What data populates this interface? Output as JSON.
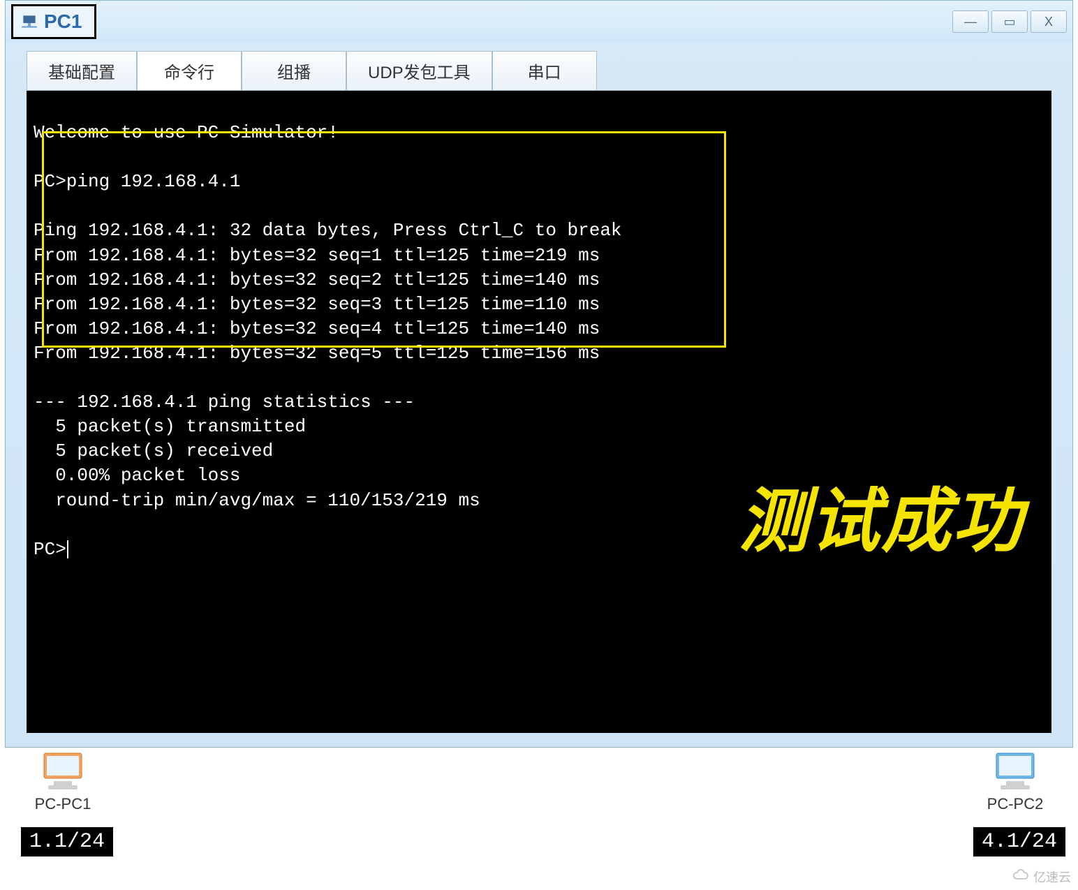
{
  "window": {
    "title": "PC1",
    "controls": {
      "min": "—",
      "max": "▭",
      "close": "X"
    }
  },
  "tabs": {
    "items": [
      {
        "label": "基础配置"
      },
      {
        "label": "命令行"
      },
      {
        "label": "组播"
      },
      {
        "label": "UDP发包工具"
      },
      {
        "label": "串口"
      }
    ],
    "active_index": 1
  },
  "terminal": {
    "lines": [
      "Welcome to use PC Simulator!",
      "",
      "PC>ping 192.168.4.1",
      "",
      "Ping 192.168.4.1: 32 data bytes, Press Ctrl_C to break",
      "From 192.168.4.1: bytes=32 seq=1 ttl=125 time=219 ms",
      "From 192.168.4.1: bytes=32 seq=2 ttl=125 time=140 ms",
      "From 192.168.4.1: bytes=32 seq=3 ttl=125 time=110 ms",
      "From 192.168.4.1: bytes=32 seq=4 ttl=125 time=140 ms",
      "From 192.168.4.1: bytes=32 seq=5 ttl=125 time=156 ms",
      "",
      "--- 192.168.4.1 ping statistics ---",
      "  5 packet(s) transmitted",
      "  5 packet(s) received",
      "  0.00% packet loss",
      "  round-trip min/avg/max = 110/153/219 ms",
      "",
      "PC>"
    ],
    "prompt": "PC>"
  },
  "annotation": {
    "success_label": "测试成功"
  },
  "topology": {
    "pc1": {
      "label": "PC-PC1",
      "ip_suffix": "1.1/24"
    },
    "pc2": {
      "label": "PC-PC2",
      "ip_suffix": "4.1/24"
    }
  },
  "watermark": {
    "text": "亿速云"
  }
}
